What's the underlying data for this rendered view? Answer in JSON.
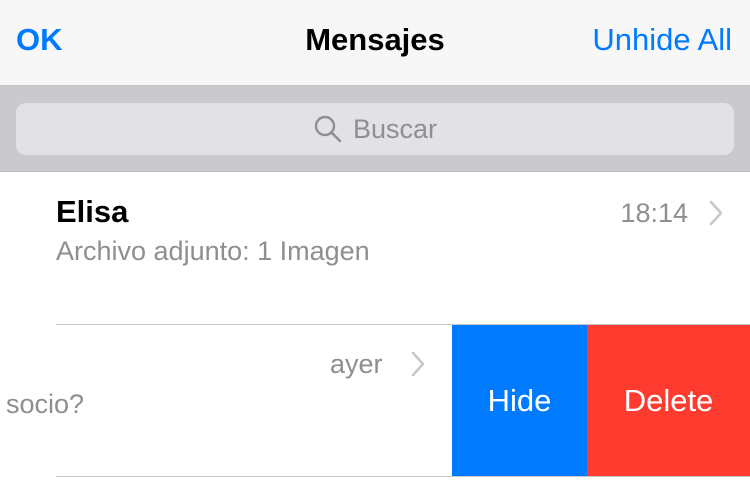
{
  "navbar": {
    "left_button": "OK",
    "title": "Mensajes",
    "right_button": "Unhide All"
  },
  "search": {
    "placeholder": "Buscar",
    "icon": "search-icon"
  },
  "conversations": [
    {
      "name": "Elisa",
      "time": "18:14",
      "preview": "Archivo adjunto: 1 Imagen"
    },
    {
      "time": "ayer",
      "preview": "socio?",
      "swipe_actions": {
        "hide": "Hide",
        "delete": "Delete"
      }
    }
  ],
  "colors": {
    "accent": "#007aff",
    "destructive": "#ff3b30",
    "secondary_text": "#8e8e93"
  }
}
